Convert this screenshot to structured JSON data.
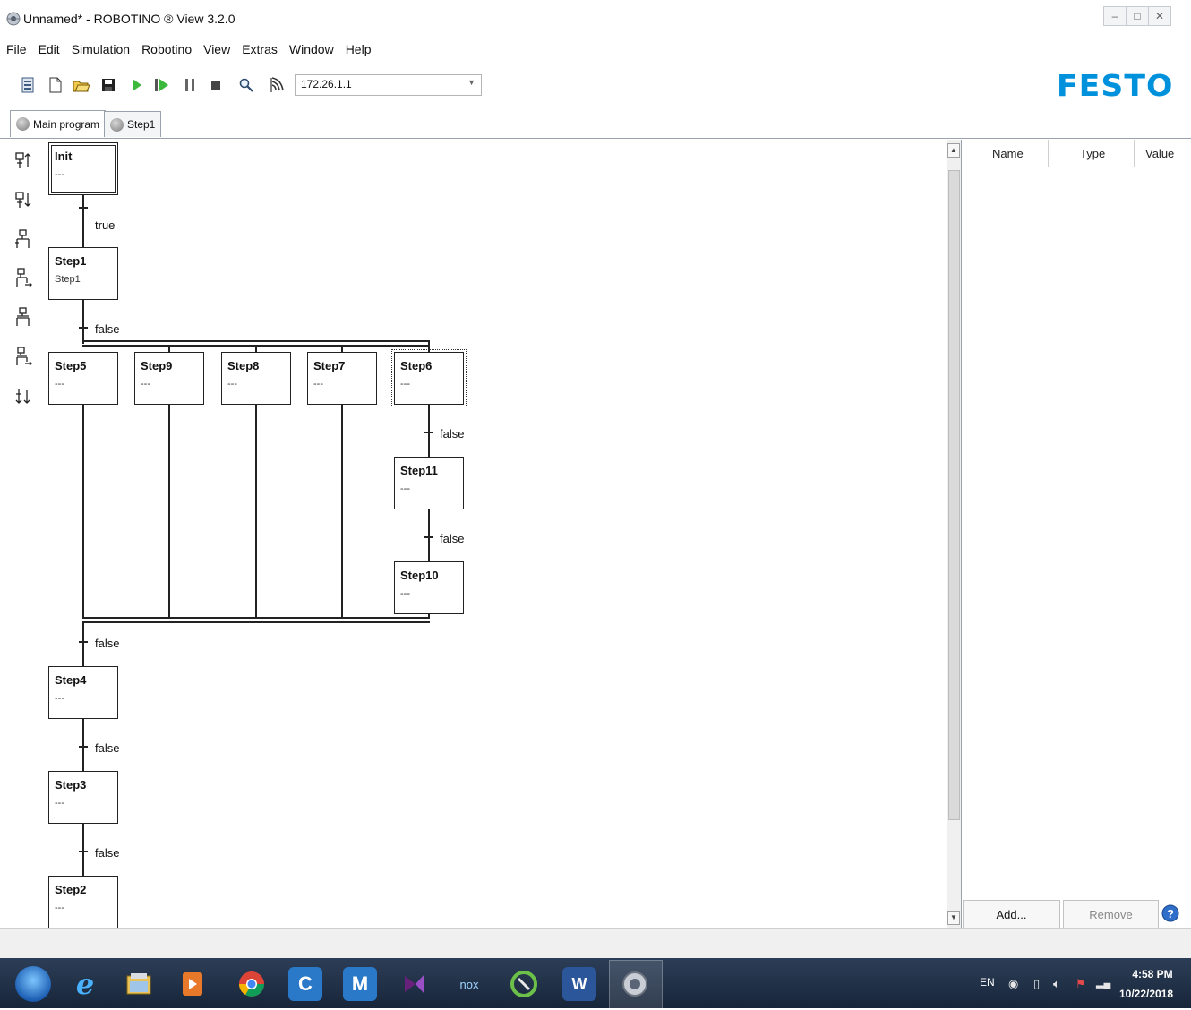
{
  "window": {
    "title": "Unnamed* - ROBOTINO ® View 3.2.0",
    "controls": [
      "–",
      "□",
      "✕"
    ]
  },
  "menu": [
    "File",
    "Edit",
    "Simulation",
    "Robotino",
    "View",
    "Extras",
    "Window",
    "Help"
  ],
  "toolbar": {
    "icons": [
      "properties-icon",
      "new-file-icon",
      "open-folder-icon",
      "save-icon",
      "run-icon",
      "step-run-icon",
      "pause-icon",
      "stop-icon",
      "search-icon",
      "wireless-connect-icon"
    ],
    "ip_address": "172.26.1.1",
    "brand": "FESTO"
  },
  "tabs": [
    {
      "label": "Main program",
      "active": true
    },
    {
      "label": "Step1",
      "active": false
    }
  ],
  "left_tools": [
    "insert-step-above-icon",
    "insert-step-below-icon",
    "insert-branch-left-icon",
    "insert-branch-right-icon",
    "insert-parallel-left-icon",
    "insert-parallel-right-icon",
    "insert-jump-icon"
  ],
  "grafcet": {
    "steps": {
      "init": {
        "name": "Init",
        "desc": "---"
      },
      "step1": {
        "name": "Step1",
        "desc": "Step1"
      },
      "step5": {
        "name": "Step5",
        "desc": "---"
      },
      "step9": {
        "name": "Step9",
        "desc": "---"
      },
      "step8": {
        "name": "Step8",
        "desc": "---"
      },
      "step7": {
        "name": "Step7",
        "desc": "---"
      },
      "step6": {
        "name": "Step6",
        "desc": "---"
      },
      "step11": {
        "name": "Step11",
        "desc": "---"
      },
      "step10": {
        "name": "Step10",
        "desc": "---"
      },
      "step4": {
        "name": "Step4",
        "desc": "---"
      },
      "step3": {
        "name": "Step3",
        "desc": "---"
      },
      "step2": {
        "name": "Step2",
        "desc": "---"
      }
    },
    "transitions": {
      "t_init_step1": "true",
      "t_step1_par": "false",
      "t_step6_step11": "false",
      "t_step11_step10": "false",
      "t_par_step4": "false",
      "t_step4_step3": "false",
      "t_step3_step2": "false"
    },
    "selected_step": "Step6"
  },
  "variables": {
    "columns": [
      "Name",
      "Type",
      "Value"
    ],
    "rows": [],
    "add_label": "Add...",
    "remove_label": "Remove"
  },
  "taskbar": {
    "apps": [
      "start-orb-icon",
      "internet-explorer-icon",
      "file-explorer-icon",
      "media-player-icon",
      "chrome-icon",
      "c-app-icon",
      "m-app-icon",
      "visual-studio-icon",
      "nox-icon",
      "green-app-icon",
      "word-icon",
      "robotino-view-icon"
    ],
    "c_label": "C",
    "m_label": "M",
    "nox_label": "nox",
    "word_label": "W",
    "language": "EN",
    "time": "4:58 PM",
    "date": "10/22/2018"
  }
}
